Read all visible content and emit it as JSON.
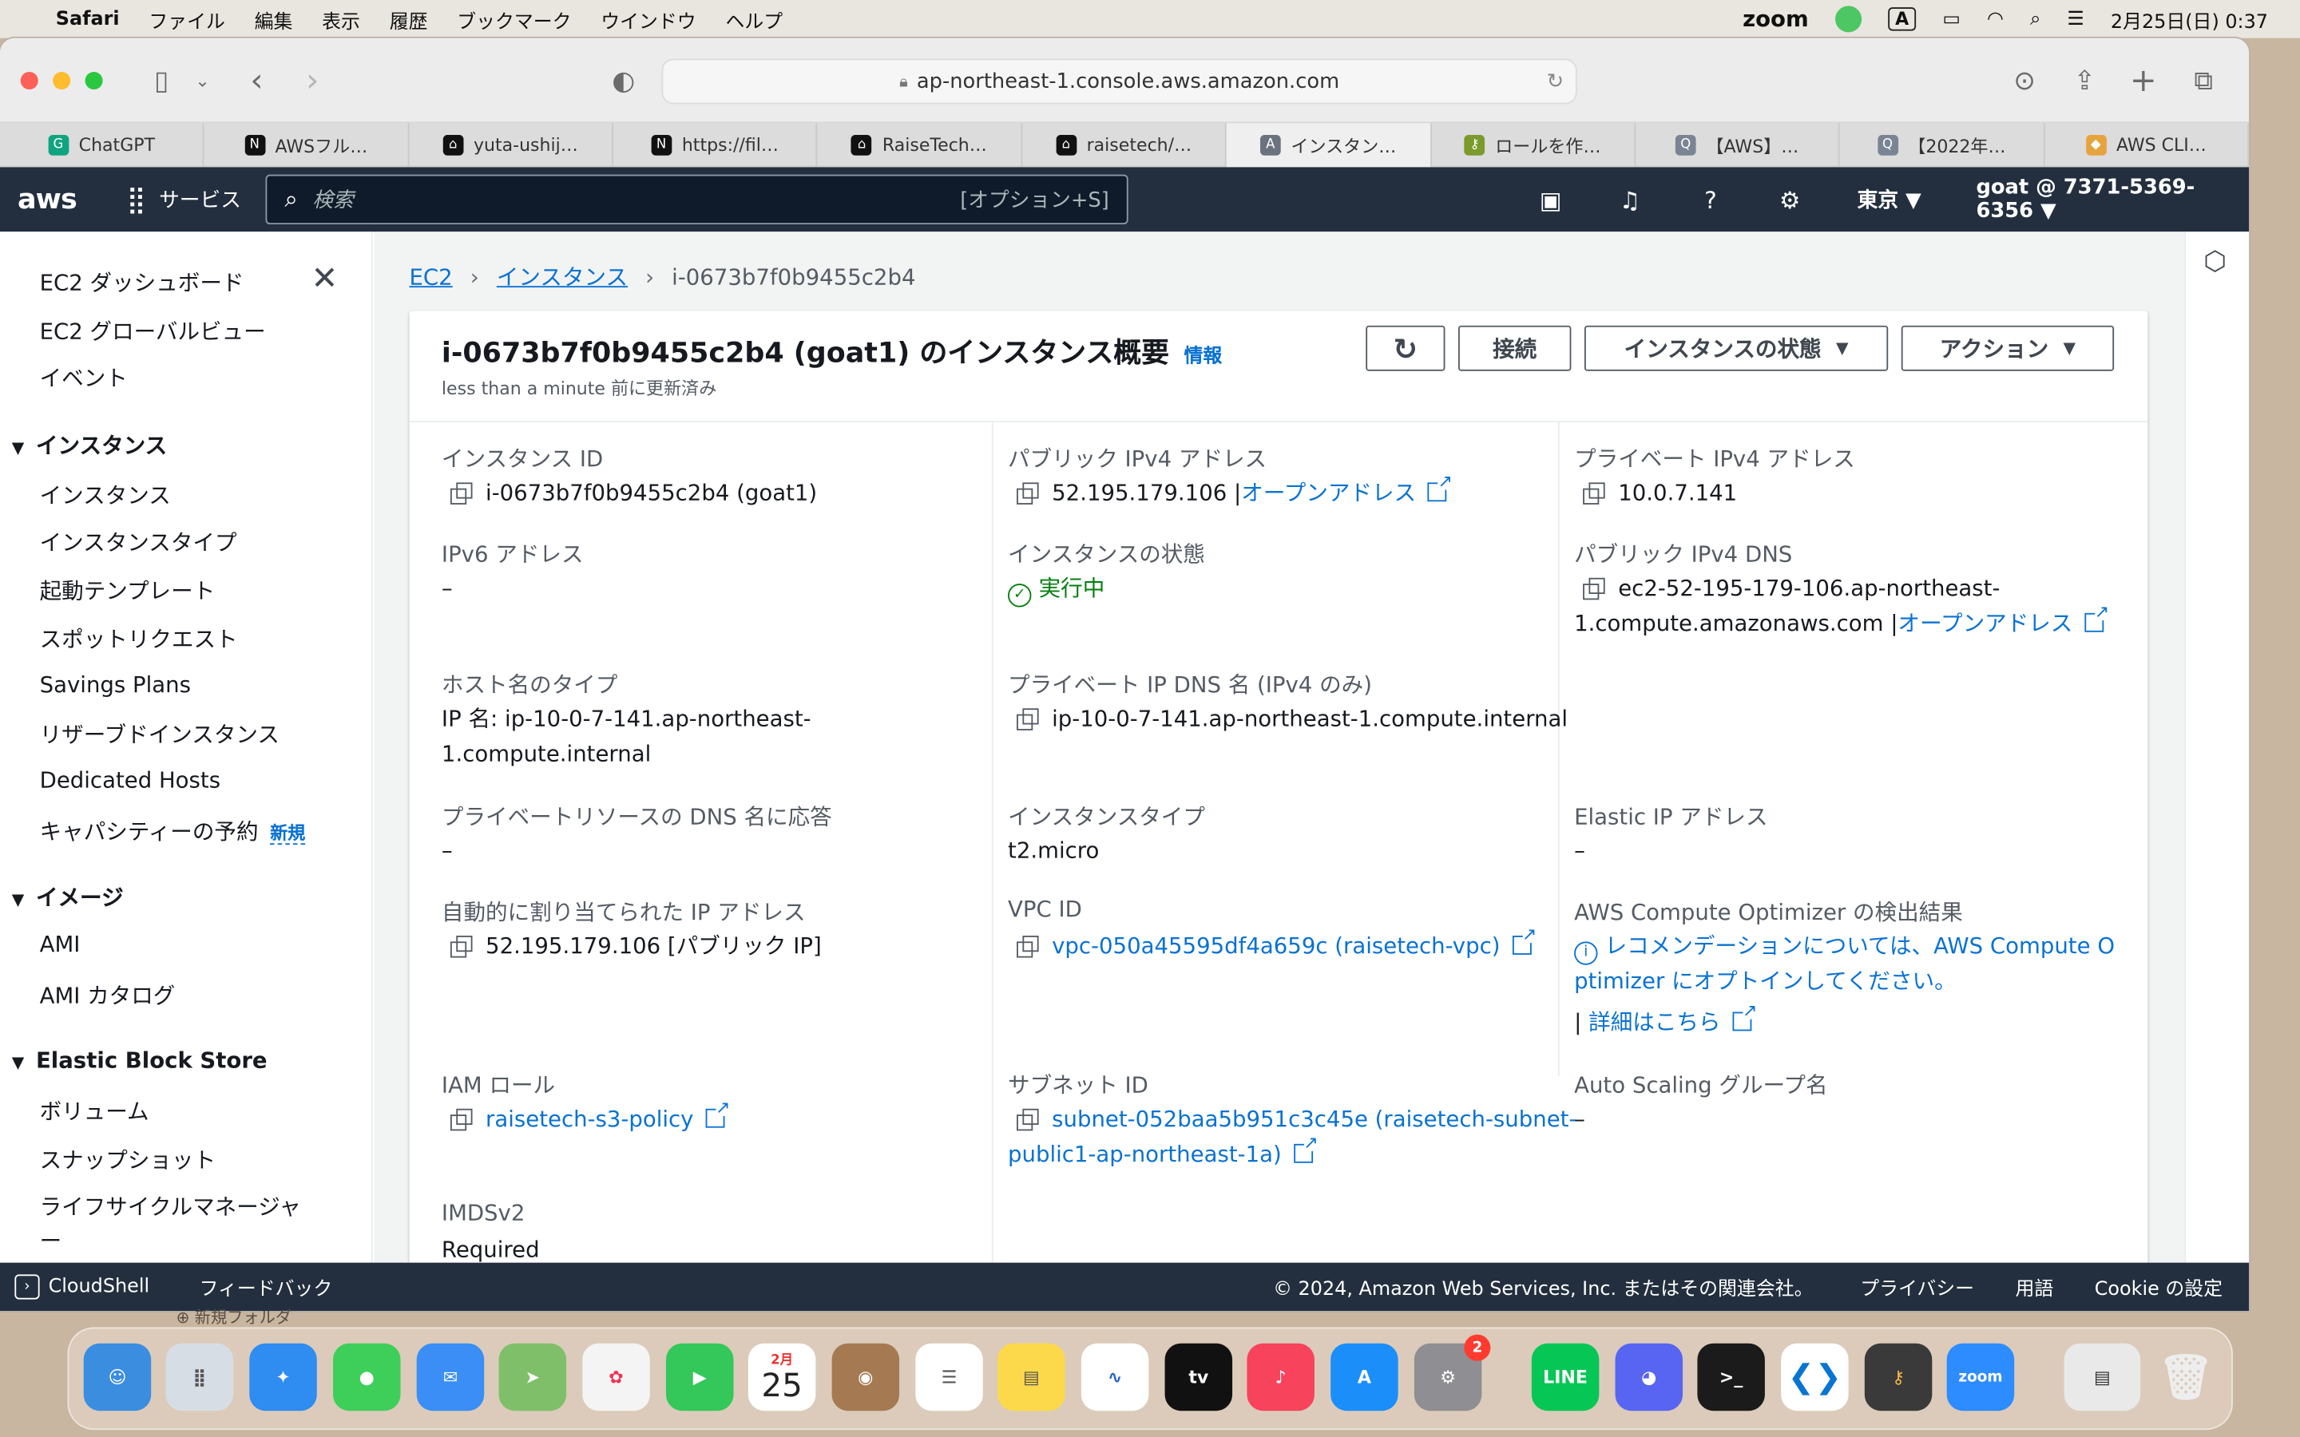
{
  "menubar": {
    "app": "Safari",
    "items": [
      "ファイル",
      "編集",
      "表示",
      "履歴",
      "ブックマーク",
      "ウインドウ",
      "ヘルプ"
    ],
    "zoom": "zoom",
    "input_indicator": "A",
    "datetime": "2月25日(日)  0:37"
  },
  "browser": {
    "url": "ap-northeast-1.console.aws.amazon.com",
    "tabs": [
      {
        "label": "ChatGPT",
        "icon": "G"
      },
      {
        "label": "AWSフル…",
        "icon": "N"
      },
      {
        "label": "yuta-ushij…",
        "icon": "⌂"
      },
      {
        "label": "https://fil…",
        "icon": "N"
      },
      {
        "label": "RaiseTech…",
        "icon": "⌂"
      },
      {
        "label": "raisetech/…",
        "icon": "⌂"
      },
      {
        "label": "インスタン…",
        "icon": "A"
      },
      {
        "label": "ロールを作…",
        "icon": "⚷"
      },
      {
        "label": "【AWS】…",
        "icon": "Q"
      },
      {
        "label": "【2022年…",
        "icon": "Q"
      },
      {
        "label": "AWS CLI…",
        "icon": "◆"
      }
    ]
  },
  "awsnav": {
    "logo": "aws",
    "services": "サービス",
    "search_placeholder": "検索",
    "search_shortcut": "[オプション+S]",
    "region": "東京 ▼",
    "account": "goat @ 7371-5369-6356 ▼"
  },
  "sidebar": {
    "items": [
      "EC2 ダッシュボード",
      "EC2 グローバルビュー",
      "イベント"
    ],
    "instances_head": "インスタンス",
    "instances": [
      "インスタンス",
      "インスタンスタイプ",
      "起動テンプレート",
      "スポットリクエスト",
      "Savings Plans",
      "リザーブドインスタンス",
      "Dedicated Hosts"
    ],
    "capacity": "キャパシティーの予約",
    "capacity_badge": "新規",
    "images_head": "イメージ",
    "images": [
      "AMI",
      "AMI カタログ"
    ],
    "ebs_head": "Elastic Block Store",
    "ebs": [
      "ボリューム",
      "スナップショット",
      "ライフサイクルマネージャ",
      "ー"
    ]
  },
  "breadcrumb": {
    "ec2": "EC2",
    "instances": "インスタンス",
    "current": "i-0673b7f0b9455c2b4"
  },
  "panel": {
    "title": "i-0673b7f0b9455c2b4 (goat1) のインスタンス概要",
    "info": "情報",
    "subtitle": "less than a minute 前に更新済み",
    "btn_connect": "接続",
    "btn_state": "インスタンスの状態",
    "btn_actions": "アクション"
  },
  "details": {
    "instance_id_label": "インスタンス ID",
    "instance_id": "i-0673b7f0b9455c2b4 (goat1)",
    "public_ipv4_label": "パブリック IPv4 アドレス",
    "public_ipv4": "52.195.179.106 |",
    "open_address": "オープンアドレス",
    "private_ipv4_label": "プライベート IPv4 アドレス",
    "private_ipv4": "10.0.7.141",
    "ipv6_label": "IPv6 アドレス",
    "ipv6": "–",
    "state_label": "インスタンスの状態",
    "state": "実行中",
    "public_dns_label": "パブリック IPv4 DNS",
    "public_dns_1": "ec2-52-195-179-106.ap-northeast-",
    "public_dns_2": "1.compute.amazonaws.com |",
    "hostname_type_label": "ホスト名のタイプ",
    "hostname_type_1": "IP 名: ip-10-0-7-141.ap-northeast-",
    "hostname_type_2": "1.compute.internal",
    "private_dns_label": "プライベート IP DNS 名 (IPv4 のみ)",
    "private_dns": "ip-10-0-7-141.ap-northeast-1.compute.internal",
    "resource_dns_label": "プライベートリソースの DNS 名に応答",
    "resource_dns": "–",
    "instance_type_label": "インスタンスタイプ",
    "instance_type": "t2.micro",
    "elastic_ip_label": "Elastic IP アドレス",
    "elastic_ip": "–",
    "auto_ip_label": "自動的に割り当てられた IP アドレス",
    "auto_ip": "52.195.179.106 [パブリック IP]",
    "vpc_label": "VPC ID",
    "vpc": "vpc-050a45595df4a659c (raisetech-vpc)",
    "optimizer_label": "AWS Compute Optimizer の検出結果",
    "optimizer_1": "レコメンデーションについては、AWS Compute O",
    "optimizer_2": "ptimizer にオプトインしてください。",
    "optimizer_more": "詳細はこちら",
    "iam_label": "IAM ロール",
    "iam": "raisetech-s3-policy",
    "subnet_label": "サブネット ID",
    "subnet_1": "subnet-052baa5b951c3c45e (raisetech-subnet-",
    "subnet_2": "public1-ap-northeast-1a)",
    "asg_label": "Auto Scaling グループ名",
    "asg": "–",
    "imds_label": "IMDSv2",
    "imds": "Required"
  },
  "footer": {
    "cloudshell": "CloudShell",
    "feedback": "フィードバック",
    "copyright": "© 2024, Amazon Web Services, Inc. またはその関連会社。",
    "privacy": "プライバシー",
    "terms": "用語",
    "cookie": "Cookie の設定"
  },
  "dock": {
    "calendar_month": "2月",
    "calendar_day": "25",
    "settings_badge": "2",
    "desktop_label": "新規フォルダ"
  }
}
